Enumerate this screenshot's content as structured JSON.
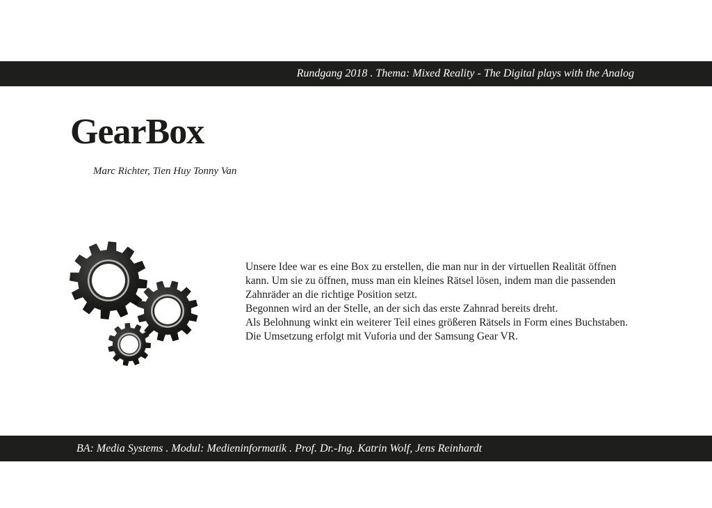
{
  "header": {
    "text": "Rundgang 2018 . Thema: Mixed Reality - The Digital plays with the Analog"
  },
  "title": "GearBox",
  "authors": "Marc Richter, Tien Huy Tonny Van",
  "illustration": {
    "icon": "gears-icon",
    "color": "#1e1e1c"
  },
  "description": {
    "lines": [
      "Unsere Idee war es eine Box zu erstellen, die man nur in der virtuellen Realität öffnen",
      "kann. Um sie zu öffnen, muss man ein kleines Rätsel lösen, indem man die passenden",
      "Zahnräder an die richtige Position setzt.",
      "Begonnen wird an der Stelle, an der sich das erste Zahnrad bereits dreht.",
      "Als Belohnung winkt ein weiterer Teil eines größeren Rätsels in Form eines Buchstaben.",
      "Die Umsetzung erfolgt mit Vuforia und der Samsung Gear VR."
    ]
  },
  "footer": {
    "text": "BA: Media Systems . Modul: Medieninformatik . Prof. Dr.-Ing. Katrin Wolf, Jens Reinhardt"
  }
}
